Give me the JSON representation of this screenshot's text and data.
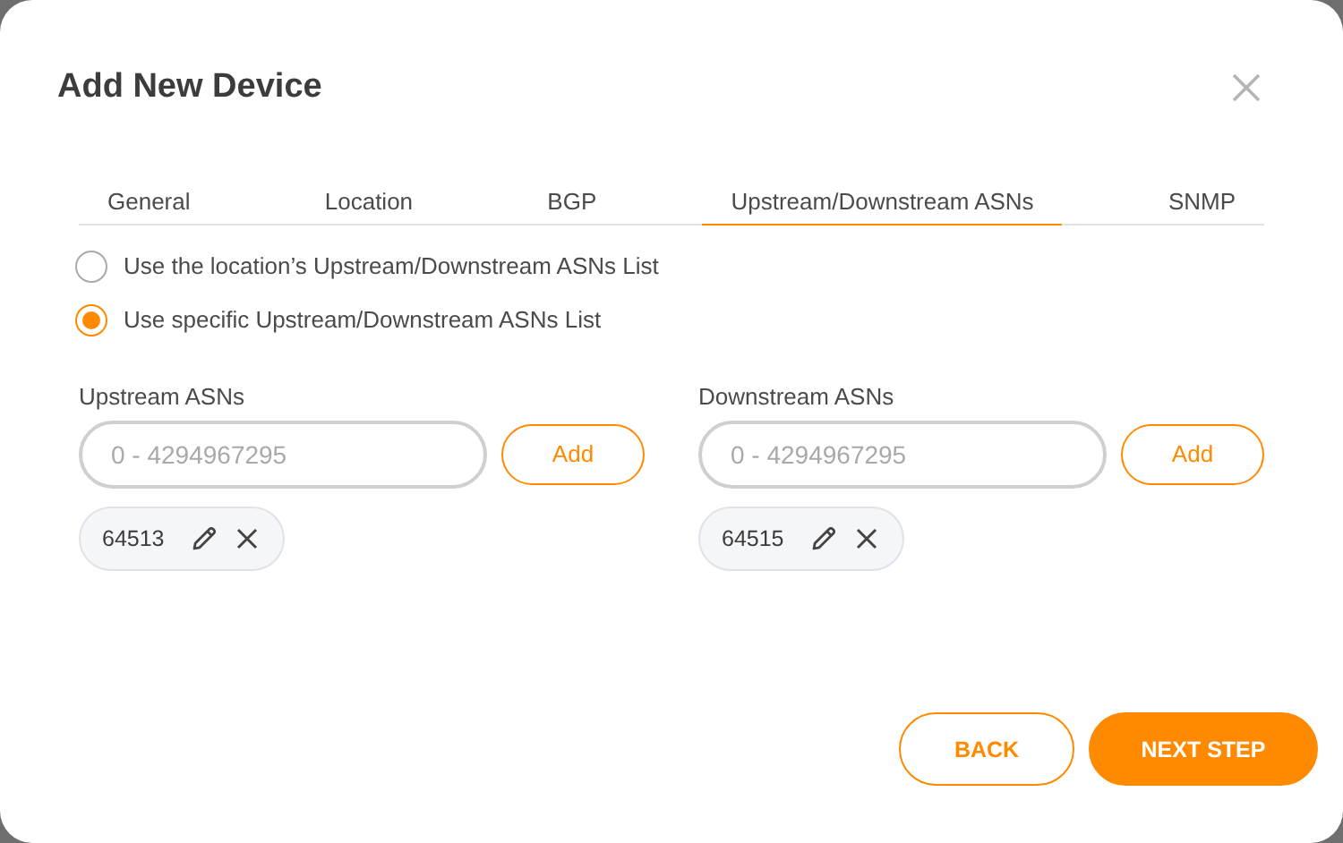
{
  "dialog": {
    "title": "Add New Device"
  },
  "tabs": [
    {
      "label": "General",
      "selected": false
    },
    {
      "label": "Location",
      "selected": false
    },
    {
      "label": "BGP",
      "selected": false
    },
    {
      "label": "Upstream/Downstream ASNs",
      "selected": true
    },
    {
      "label": "SNMP",
      "selected": false
    }
  ],
  "options": [
    {
      "label": "Use the location’s Upstream/Downstream ASNs List",
      "selected": false
    },
    {
      "label": "Use specific Upstream/Downstream ASNs List",
      "selected": true
    }
  ],
  "lists": [
    {
      "label": "Upstream ASNs",
      "placeholder": "0 - 4294967295",
      "add": "Add",
      "chips": [
        "64513"
      ]
    },
    {
      "label": "Downstream ASNs",
      "placeholder": "0 - 4294967295",
      "add": "Add",
      "chips": [
        "64515"
      ]
    }
  ],
  "buttons": [
    {
      "label": "BACK",
      "kind": "secondary"
    },
    {
      "label": "NEXT STEP",
      "kind": "primary"
    }
  ]
}
